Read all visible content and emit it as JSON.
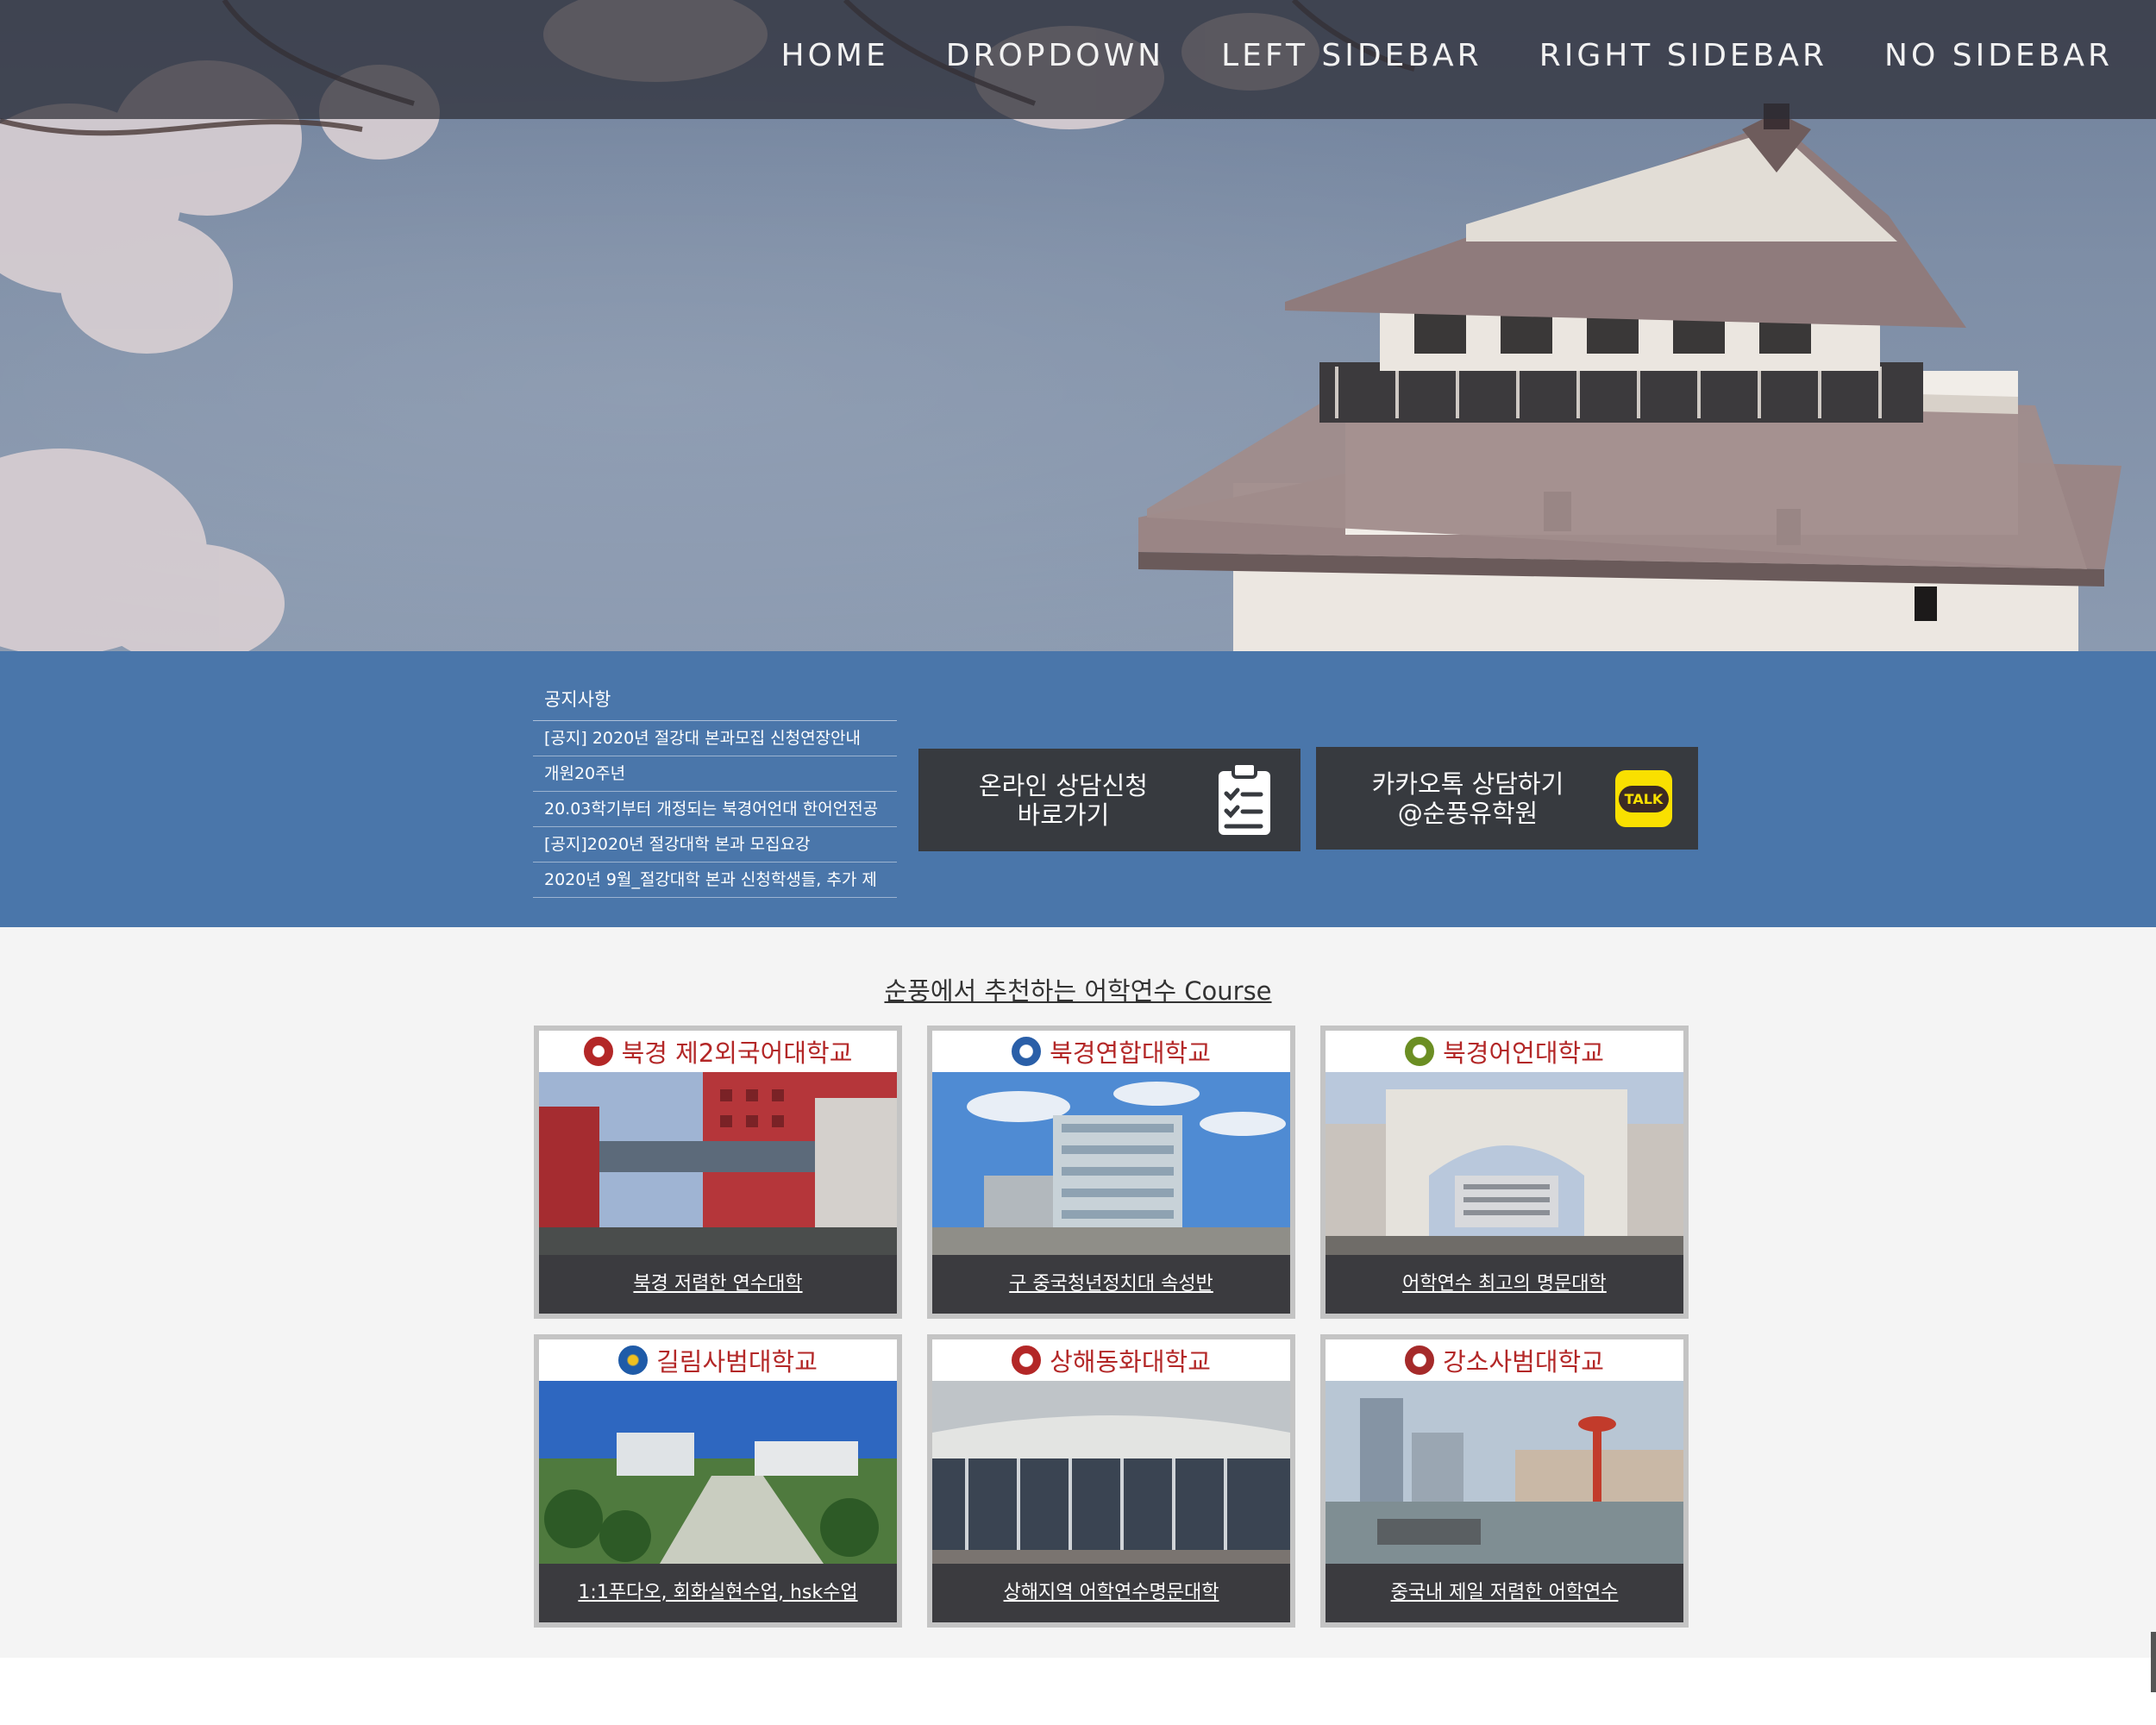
{
  "nav": {
    "items": [
      "HOME",
      "DROPDOWN",
      "LEFT SIDEBAR",
      "RIGHT SIDEBAR",
      "NO SIDEBAR"
    ]
  },
  "notice": {
    "title": "공지사항",
    "items": [
      "[공지] 2020년 절강대 본과모집 신청연장안내",
      "개원20주년",
      "20.03학기부터 개정되는 북경어언대 한어언전공",
      "[공지]2020년 절강대학 본과 모집요강",
      "2020년 9월_절강대학 본과 신청학생들, 추가 제"
    ]
  },
  "cta": {
    "online": {
      "line1": "온라인 상담신청",
      "line2": "바로가기",
      "icon": "clipboard-check-icon"
    },
    "kakao": {
      "line1": "카카오톡 상담하기",
      "line2": "@순풍유학원",
      "badge": "TALK",
      "icon": "kakaotalk-icon"
    }
  },
  "courses": {
    "title": "순풍에서 추천하는 어학연수 Course",
    "cards": [
      {
        "name": "북경 제2외국어대학교",
        "caption": "북경 저렴한 연수대학"
      },
      {
        "name": "북경연합대학교",
        "caption": "구 중국청년정치대 속성반"
      },
      {
        "name": "북경어언대학교",
        "caption": "어학연수 최고의 명문대학"
      },
      {
        "name": "길림사범대학교",
        "caption": "1:1푸다오, 회화실현수업, hsk수업"
      },
      {
        "name": "상해동화대학교",
        "caption": "상해지역 어학연수명문대학"
      },
      {
        "name": "강소사범대학교",
        "caption": "중국내 제일 저렴한 어학연수"
      }
    ]
  },
  "colors": {
    "navbar": "#2d2d34",
    "band": "#4a76aa",
    "cta": "#373a3f",
    "kakao_yellow": "#f9e000",
    "card_name": "#b32727",
    "caption_bg": "#3b3b3f"
  }
}
